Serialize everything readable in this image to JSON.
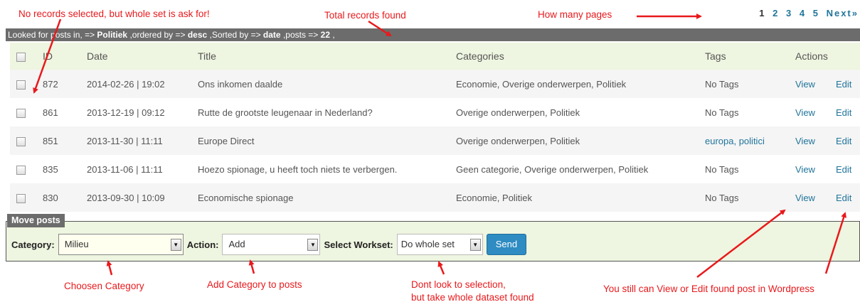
{
  "annotations": {
    "no_records": "No records selected, but whole set is ask for!",
    "total_records": "Total records found",
    "how_many_pages": "How many pages",
    "chosen_category": "Choosen Category",
    "add_category": "Add Category to posts",
    "dont_look_line1": "Dont look to selection,",
    "dont_look_line2": "but take whole dataset found",
    "view_edit": "You still can View or Edit found post in Wordpress"
  },
  "pagination": {
    "pages": [
      "1",
      "2",
      "3",
      "4",
      "5"
    ],
    "next_label": "Next»",
    "current_page": "1"
  },
  "info_bar": {
    "prefix": "Looked for posts in, => ",
    "category": "Politiek",
    "order_text": " ,ordered by => ",
    "order": "desc",
    "sort_text": " ,Sorted by => ",
    "sort": "date",
    "posts_text": " ,posts => ",
    "posts": "22",
    "suffix": " ,"
  },
  "table": {
    "headers": {
      "id": "ID",
      "date": "Date",
      "title": "Title",
      "categories": "Categories",
      "tags": "Tags",
      "actions": "Actions"
    },
    "view_label": "View",
    "edit_label": "Edit",
    "rows": [
      {
        "id": "872",
        "date": "2014-02-26 | 19:02",
        "title": "Ons inkomen daalde",
        "categories": "Economie, Overige onderwerpen, Politiek",
        "tags": "No Tags",
        "tags_link": false
      },
      {
        "id": "861",
        "date": "2013-12-19 | 09:12",
        "title": "Rutte de grootste leugenaar in Nederland?",
        "categories": "Overige onderwerpen, Politiek",
        "tags": "No Tags",
        "tags_link": false
      },
      {
        "id": "851",
        "date": "2013-11-30 | 11:11",
        "title": "Europe Direct",
        "categories": "Overige onderwerpen, Politiek",
        "tags": "europa, politici",
        "tags_link": true
      },
      {
        "id": "835",
        "date": "2013-11-06 | 11:11",
        "title": "Hoezo spionage, u heeft toch niets te verbergen.",
        "categories": "Geen categorie, Overige onderwerpen, Politiek",
        "tags": "No Tags",
        "tags_link": false
      },
      {
        "id": "830",
        "date": "2013-09-30 | 10:09",
        "title": "Economische spionage",
        "categories": "Economie, Politiek",
        "tags": "No Tags",
        "tags_link": false
      }
    ]
  },
  "move_posts": {
    "legend": "Move posts",
    "category_label": "Category:",
    "category_value": "Milieu",
    "action_label": "Action:",
    "action_value": "Add",
    "workset_label": "Select Workset:",
    "workset_value": "Do whole set",
    "send_label": "Send"
  },
  "colors": {
    "annotation_red": "#e8191c",
    "link_blue": "#21759b",
    "send_button": "#2e8cc2",
    "panel_green": "#eef5e0",
    "info_bar_gray": "#6c6c6c"
  },
  "icons": {
    "select_arrow": "caret-down-icon",
    "checkbox": "checkbox-icon"
  }
}
